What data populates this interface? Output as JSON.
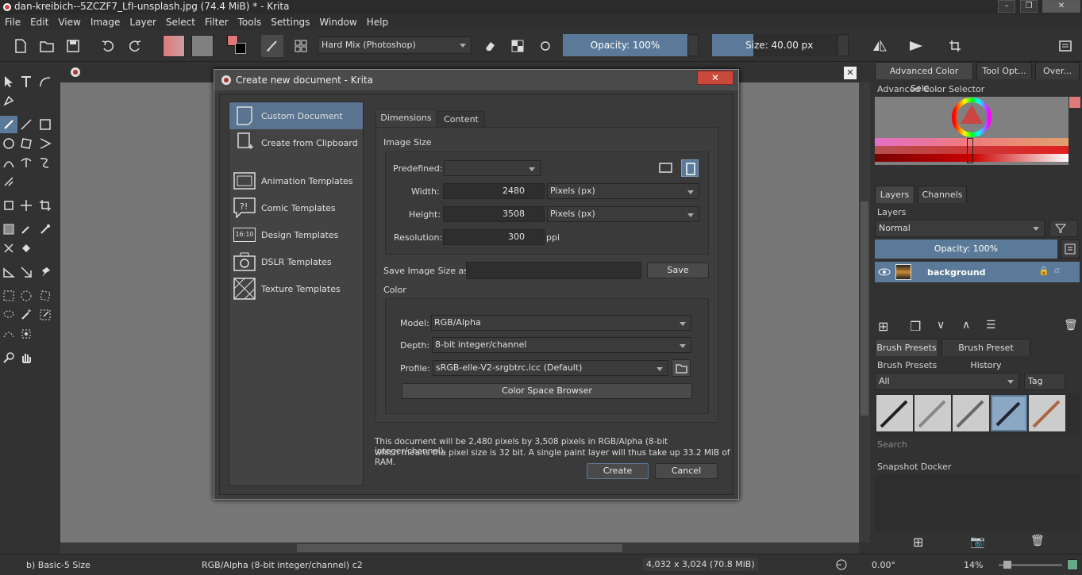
{
  "window": {
    "title": "dan-kreibich--5ZCZF7_LfI-unsplash.jpg (74.4 MiB)  * - Krita"
  },
  "menu": [
    "File",
    "Edit",
    "View",
    "Image",
    "Layer",
    "Select",
    "Filter",
    "Tools",
    "Settings",
    "Window",
    "Help"
  ],
  "toolbar": {
    "blend_mode": "Hard Mix (Photoshop)",
    "opacity": "Opacity: 100%",
    "size": "Size: 40.00 px"
  },
  "dock": {
    "tabs_top": [
      "Advanced Color Sele...",
      "Tool Opt...",
      "Over..."
    ],
    "color_selector_title": "Advanced Color Selector",
    "layers_tabs": [
      "Layers",
      "Channels"
    ],
    "layers_title": "Layers",
    "layer_mode": "Normal",
    "layer_opacity": "Opacity:  100%",
    "layer_name": "background",
    "brush_tabs": [
      "Brush Presets",
      "Brush Preset History"
    ],
    "brush_title": "Brush Presets",
    "brush_filter": "All",
    "brush_tag": "Tag",
    "brush_search": "Search",
    "snapshot_title": "Snapshot Docker"
  },
  "status": {
    "brush": "b) Basic-5 Size",
    "colorspace": "RGB/Alpha (8-bit integer/channel)  c2",
    "image_size": "4,032 x 3,024 (70.8 MiB)",
    "rotation": "0.00°",
    "zoom": "14%"
  },
  "dialog": {
    "title": "Create new document - Krita",
    "side_items": [
      "Custom Document",
      "Create from Clipboard",
      "Animation Templates",
      "Comic Templates",
      "Design Templates",
      "DSLR Templates",
      "Texture Templates"
    ],
    "design_icon_text": "16:10",
    "tabs": [
      "Dimensions",
      "Content"
    ],
    "image_size_group": "Image Size",
    "predefined_label": "Predefined:",
    "width_label": "Width:",
    "width_value": "2480",
    "width_unit": "Pixels (px)",
    "height_label": "Height:",
    "height_value": "3508",
    "height_unit": "Pixels (px)",
    "resolution_label": "Resolution:",
    "resolution_value": "300",
    "resolution_unit": "ppi",
    "save_size_label": "Save Image Size as:",
    "save_button": "Save",
    "color_group": "Color",
    "model_label": "Model:",
    "model_value": "RGB/Alpha",
    "depth_label": "Depth:",
    "depth_value": "8-bit integer/channel",
    "profile_label": "Profile:",
    "profile_value": "sRGB-elle-V2-srgbtrc.icc (Default)",
    "color_space_browser": "Color Space Browser",
    "summary_line1": "This document will be 2,480 pixels by 3,508 pixels in RGB/Alpha (8-bit integer/channel),",
    "summary_line2": "which means the pixel size is 32 bit. A single paint layer will thus take up 33.2 MiB of RAM.",
    "create_button": "Create",
    "cancel_button": "Cancel"
  }
}
